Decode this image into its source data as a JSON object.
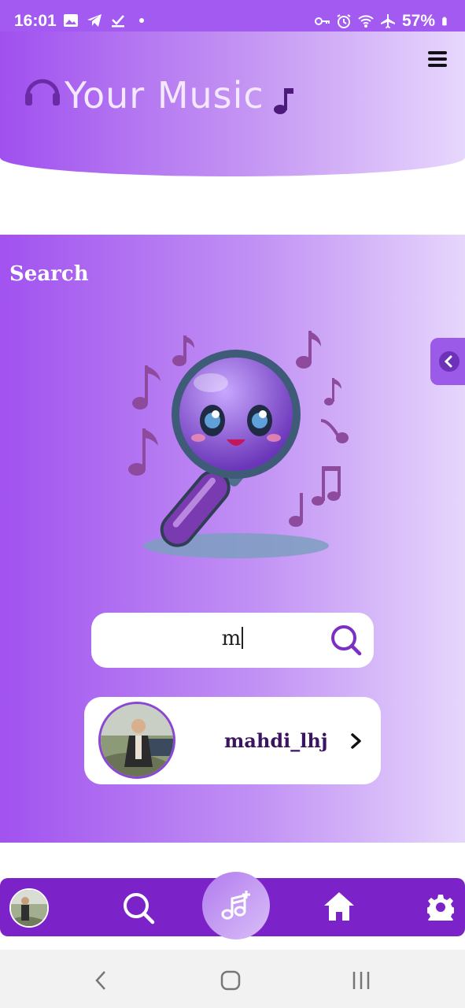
{
  "status_bar": {
    "time": "16:01",
    "battery": "57%",
    "left_icons": [
      "image-icon",
      "telegram-icon",
      "download-done-icon",
      "dot-icon"
    ],
    "right_icons": [
      "vpn-key-icon",
      "alarm-icon",
      "wifi-icon",
      "airplane-icon",
      "battery-icon"
    ]
  },
  "header": {
    "app_name": "Your Music",
    "logo_icons": [
      "headphones-icon",
      "music-note-icon"
    ],
    "menu_icon": "hamburger-menu-icon"
  },
  "search_page": {
    "title": "Search",
    "side_tab_icon": "chevron-left-icon",
    "mascot": "magnifier-mascot-with-music-notes",
    "input_value": "m",
    "search_icon": "search-icon"
  },
  "results": [
    {
      "username": "mahdi_lhj",
      "avatar_icon": "user-avatar",
      "arrow_icon": "chevron-right-icon"
    }
  ],
  "bottom_nav": {
    "items": [
      "profile-avatar",
      "search-icon",
      "add-music-icon",
      "home-icon",
      "settings-icon"
    ]
  },
  "system_nav": [
    "back-icon",
    "home-circle-icon",
    "recents-icon"
  ],
  "colors": {
    "accent": "#7b23c8",
    "gradient_start": "#a152ef",
    "gradient_end": "#e6d6fc",
    "card": "#ffffff",
    "username": "#3a1460"
  }
}
